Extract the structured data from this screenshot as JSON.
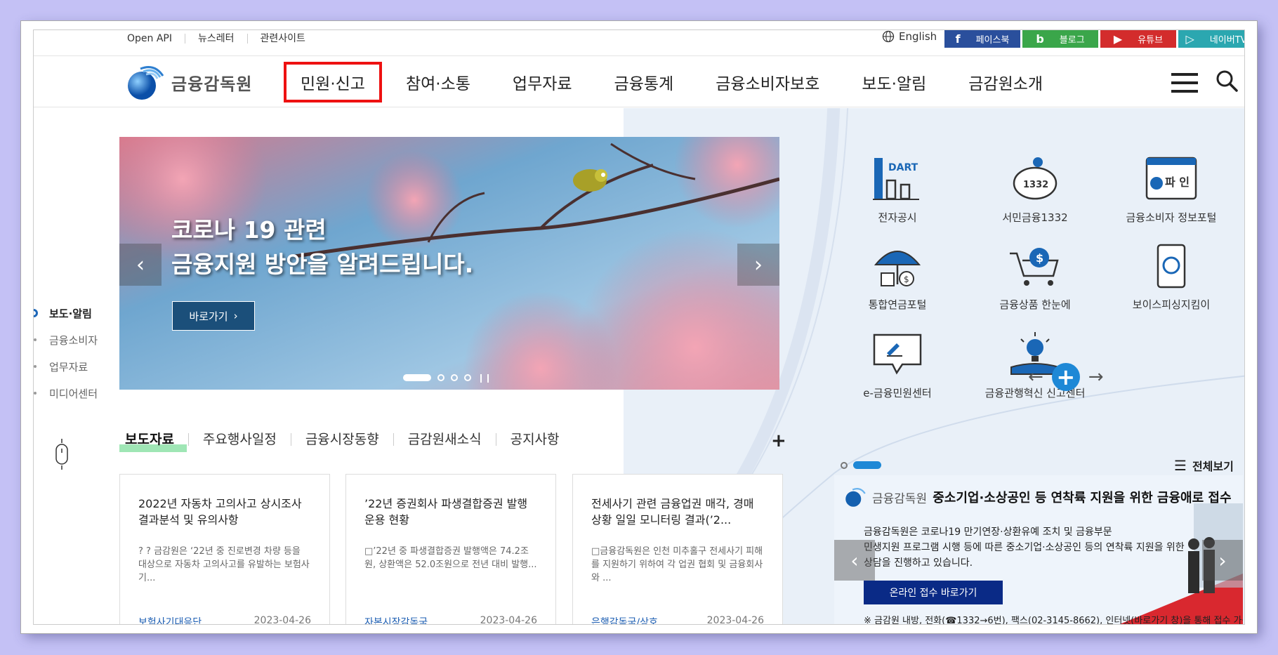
{
  "util_links": [
    "Open API",
    "뉴스레터",
    "관련사이트"
  ],
  "lang": "English",
  "sns": {
    "facebook": "페이스북",
    "blog": "블로그",
    "youtube": "유튜브",
    "navertv": "네이버TV"
  },
  "logo": "금융감독원",
  "menu": [
    "민원·신고",
    "참여·소통",
    "업무자료",
    "금융통계",
    "금융소비자보호",
    "보도·알림",
    "금감원소개"
  ],
  "side_nav": [
    "보도·알림",
    "금융소비자",
    "업무자료",
    "미디어센터"
  ],
  "banner": {
    "line1": "코로나 19 관련",
    "line2": "금융지원 방안을 알려드립니다.",
    "button": "바로가기"
  },
  "quick": [
    {
      "label": "전자공시",
      "icon": "dart-icon",
      "badge": "DART"
    },
    {
      "label": "서민금융1332",
      "icon": "piggy-bank-icon",
      "badge": "1332"
    },
    {
      "label": "금융소비자 정보포털",
      "icon": "fine-portal-icon",
      "badge": "파 인"
    },
    {
      "label": "통합연금포털",
      "icon": "umbrella-pension-icon"
    },
    {
      "label": "금융상품 한눈에",
      "icon": "shopping-cart-icon"
    },
    {
      "label": "보이스피싱지킴이",
      "icon": "phone-icon"
    },
    {
      "label": "e-금융민원센터",
      "icon": "pencil-bubble-icon"
    },
    {
      "label": "금융관행혁신 신고센터",
      "icon": "lightbulb-book-icon"
    }
  ],
  "tabs": [
    "보도자료",
    "주요행사일정",
    "금융시장동향",
    "금감원새소식",
    "공지사항"
  ],
  "cards": [
    {
      "title": "2022년 자동차 고의사고 상시조사 결과분석 및 유의사항",
      "summary": "? ? 금감원은 ‘22년 중 진로변경 차량 등을 대상으로 자동차 고의사고를 유발하는 보험사기...",
      "dept": "보험사기대응단",
      "date": "2023-04-26"
    },
    {
      "title": "’22년 증권회사 파생결합증권 발행 운용 현황",
      "summary": "□’22년 중 파생결합증권 발행액은 74.2조원, 상환액은 52.0조원으로 전년 대비 발행...",
      "dept": "자본시장감독국",
      "date": "2023-04-26"
    },
    {
      "title": "전세사기 관련 금융업권 매각, 경매상황 일일 모니터링 결과(’2...",
      "summary": "□금융감독원은 인천 미추홀구 전세사기 피해를 지원하기 위하여 각 업권 협회 및 금융회사와 ...",
      "dept": "은행감독국/상호...",
      "date": "2023-04-26"
    }
  ],
  "all_view": "전체보기",
  "notice": {
    "org": "금융감독원",
    "title": "중소기업·소상공인 등 연착륙 지원을 위한 금융애로 접수",
    "body1": "금융감독원은 코로나19 만기연장·상환유예 조치 및 금융부문",
    "body2": "민생지원 프로그램 시행 등에 따른 중소기업·소상공인 등의 연착륙 지원을 위한",
    "body3": "상담을 진행하고 있습니다.",
    "button": "온라인 접수 바로가기",
    "footer": "※ 금감원 내방, 전화(☎1332→6번), 팩스(02-3145-8662), 인터넷(바로가기 창)을 통해 접수 가능"
  },
  "colors": {
    "accent": "#1e88d6",
    "highlight": "#e11111",
    "navy": "#0a2a86"
  }
}
